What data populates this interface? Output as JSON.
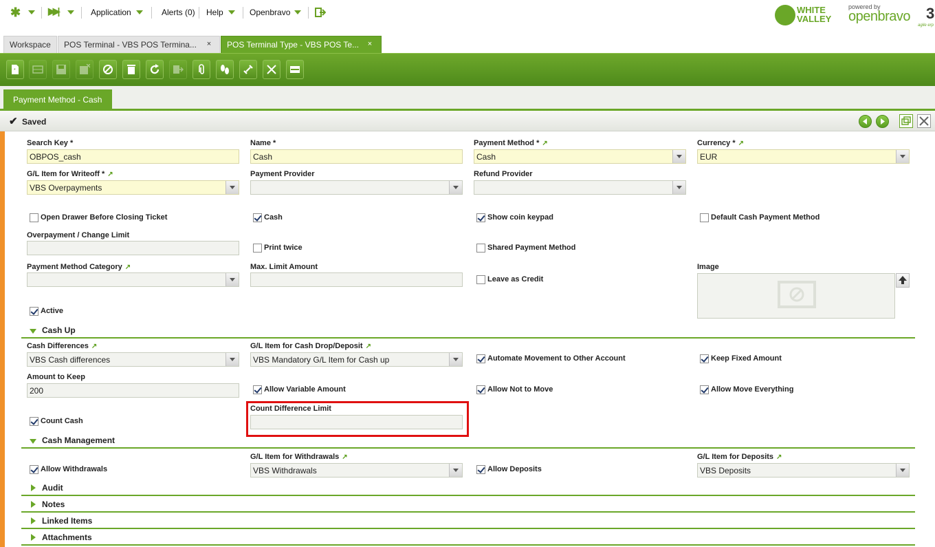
{
  "topbar": {
    "application": "Application",
    "alerts": "Alerts (0)",
    "help": "Help",
    "user": "Openbravo",
    "brand_wv_1": "WHITE",
    "brand_wv_2": "VALLEY",
    "powered_by": "powered by",
    "openbravo": "openbravo",
    "version": "3",
    "tagline": "agile erp"
  },
  "tabs": [
    {
      "label": "Workspace"
    },
    {
      "label": "POS Terminal - VBS POS Termina..."
    },
    {
      "label": "POS Terminal Type - VBS POS Te..."
    }
  ],
  "close_glyph": "×",
  "subtab": "Payment Method - Cash",
  "status": "Saved",
  "fields": {
    "search_key": {
      "label": "Search Key *",
      "value": "OBPOS_cash"
    },
    "name": {
      "label": "Name *",
      "value": "Cash"
    },
    "payment_method": {
      "label": "Payment Method *",
      "value": "Cash"
    },
    "currency": {
      "label": "Currency *",
      "value": "EUR"
    },
    "gl_writeoff": {
      "label": "G/L Item for Writeoff *",
      "value": "VBS Overpayments"
    },
    "payment_provider": {
      "label": "Payment Provider",
      "value": ""
    },
    "refund_provider": {
      "label": "Refund Provider",
      "value": ""
    },
    "overpayment_limit": {
      "label": "Overpayment / Change Limit",
      "value": ""
    },
    "payment_method_category": {
      "label": "Payment Method Category",
      "value": ""
    },
    "max_limit_amount": {
      "label": "Max. Limit Amount",
      "value": ""
    },
    "image": {
      "label": "Image"
    },
    "cash_differences": {
      "label": "Cash Differences",
      "value": "VBS Cash differences"
    },
    "gl_cash_drop": {
      "label": "G/L Item for Cash Drop/Deposit",
      "value": "VBS Mandatory G/L Item for Cash up"
    },
    "amount_to_keep": {
      "label": "Amount to Keep",
      "value": "200"
    },
    "count_difference_limit": {
      "label": "Count Difference Limit",
      "value": ""
    },
    "gl_withdrawals": {
      "label": "G/L Item for Withdrawals",
      "value": "VBS Withdrawals"
    },
    "gl_deposits": {
      "label": "G/L Item for Deposits",
      "value": "VBS Deposits"
    }
  },
  "checkboxes": {
    "open_drawer": {
      "label": "Open Drawer Before Closing Ticket",
      "checked": false
    },
    "cash": {
      "label": "Cash",
      "checked": true
    },
    "show_coin_keypad": {
      "label": "Show coin keypad",
      "checked": true
    },
    "default_cash": {
      "label": "Default Cash Payment Method",
      "checked": false
    },
    "print_twice": {
      "label": "Print twice",
      "checked": false
    },
    "shared_payment": {
      "label": "Shared Payment Method",
      "checked": false
    },
    "leave_as_credit": {
      "label": "Leave as Credit",
      "checked": false
    },
    "active": {
      "label": "Active",
      "checked": true
    },
    "automate_movement": {
      "label": "Automate Movement to Other Account",
      "checked": true
    },
    "keep_fixed_amount": {
      "label": "Keep Fixed Amount",
      "checked": true
    },
    "allow_variable_amount": {
      "label": "Allow Variable Amount",
      "checked": true
    },
    "allow_not_to_move": {
      "label": "Allow Not to Move",
      "checked": true
    },
    "allow_move_everything": {
      "label": "Allow Move Everything",
      "checked": true
    },
    "count_cash": {
      "label": "Count Cash",
      "checked": true
    },
    "allow_withdrawals": {
      "label": "Allow Withdrawals",
      "checked": true
    },
    "allow_deposits": {
      "label": "Allow Deposits",
      "checked": true
    }
  },
  "sections": {
    "cash_up": "Cash Up",
    "cash_management": "Cash Management",
    "audit": "Audit",
    "notes": "Notes",
    "linked_items": "Linked Items",
    "attachments": "Attachments"
  },
  "colors": {
    "accent": "#6aa728",
    "highlight": "#e01010",
    "required_bg": "#fcfbd3"
  }
}
